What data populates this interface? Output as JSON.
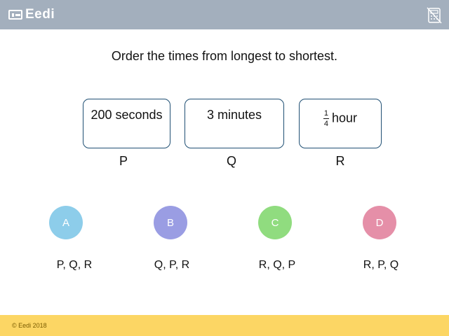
{
  "header": {
    "logo_text": "Eedi",
    "logo_icon": "eedi-logo-icon",
    "calculator_icon": "calculator-disabled-icon",
    "bar_color": "#a3afbd"
  },
  "question": {
    "text": "Order the times from longest to shortest."
  },
  "cards": [
    {
      "label": "P",
      "text": "200 seconds"
    },
    {
      "label": "Q",
      "text": "3 minutes"
    },
    {
      "label": "R",
      "numerator": "1",
      "denominator": "4",
      "text": "hour"
    }
  ],
  "options": [
    {
      "letter": "A",
      "answer": "P, Q, R",
      "color": "#8dcdea"
    },
    {
      "letter": "B",
      "answer": "Q, P, R",
      "color": "#9a9de3"
    },
    {
      "letter": "C",
      "answer": "R, Q, P",
      "color": "#90dc7f"
    },
    {
      "letter": "D",
      "answer": "R, P, Q",
      "color": "#e58fa8"
    }
  ],
  "footer": {
    "copyright": "© Eedi 2018",
    "color": "#fcd664"
  }
}
